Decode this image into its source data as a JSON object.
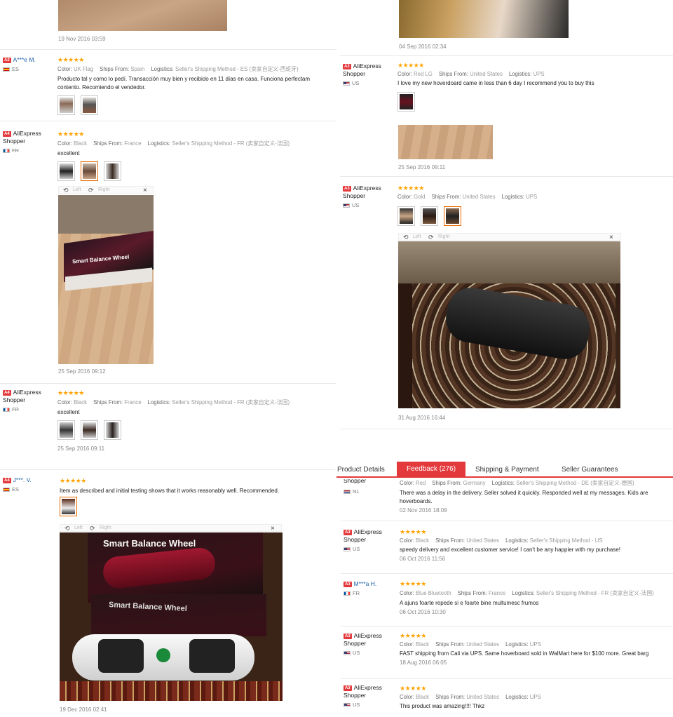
{
  "tabs": [
    "Product Details",
    "Feedback (276)",
    "Shipping & Payment",
    "Seller Guarantees"
  ],
  "viewer": {
    "left": "Left",
    "right": "Right",
    "close": "×"
  },
  "labels": {
    "color": "Color:",
    "ships_from": "Ships From:",
    "logistics": "Logistics:"
  },
  "stars": "★★★★★",
  "q1": {
    "top_date": "19 Nov 2016 03:59",
    "reviews": [
      {
        "level": "A2",
        "name": "A***e M.",
        "country": "ES",
        "color": "UK Flag",
        "ships_from": "Spain",
        "logistics": "Seller's Shipping Method - ES (卖家自定义-西班牙)",
        "text": "Producto tal y como lo pedí. Transacción muy bien y recibido en 11 días en casa. Funciona perfectam",
        "text2": "contento. Recomiendo el vendedor."
      },
      {
        "level": "A4",
        "name": "AliExpress",
        "name2": "Shopper",
        "country": "FR",
        "color": "Black",
        "ships_from": "France",
        "logistics": "Seller's Shipping Method - FR (卖家自定义-法国)",
        "text": "excellent",
        "date": "25 Sep 2016 09:12"
      },
      {
        "level": "A4",
        "name": "AliExpress",
        "name2": "Shopper",
        "country": "FR",
        "color": "Black",
        "ships_from": "France",
        "logistics": "Seller's Shipping Method - FR (卖家自定义-法国)",
        "text": "excellent",
        "date": "25 Sep 2016 09:11"
      }
    ],
    "photo_text": [
      "Smart Balance Wheel"
    ]
  },
  "q2": {
    "top_date": "04 Sep 2016 02:34",
    "reviews": [
      {
        "level": "A2",
        "name": "AliExpress",
        "name2": "Shopper",
        "country": "US",
        "color": "Red LG",
        "ships_from": "United States",
        "logistics": "UPS",
        "text": "I love my new hoverdoard came in less than 6 day I recommend you to buy this",
        "date": "25 Sep 2016 09:11"
      },
      {
        "level": "A3",
        "name": "AliExpress",
        "name2": "Shopper",
        "country": "US",
        "color": "Gold",
        "ships_from": "United States",
        "logistics": "UPS",
        "date": "31 Aug 2016 16:44"
      }
    ]
  },
  "q3": {
    "review": {
      "level": "A4",
      "name": "J***. V.",
      "country": "ES",
      "text": "Item as described and initial testing shows that it works reasonably well. Recommended.",
      "date": "19 Dec 2016 02:41"
    },
    "photo_text": [
      "Smart Balance Wheel",
      "Smart Balance Wheel"
    ]
  },
  "q4": {
    "reviews": [
      {
        "name": "Shopper",
        "country": "NL",
        "color": "Red",
        "ships_from": "Germany",
        "logistics": "Seller's Shipping Method - DE (卖家自定义-德国)",
        "text": "There was a delay in the delivery. Seller solved it quickly. Responded well at my messages. Kids are",
        "text2": "hoverboards.",
        "date": "02 Nov 2016 18:09"
      },
      {
        "level": "A3",
        "name": "AliExpress",
        "name2": "Shopper",
        "country": "US",
        "color": "Black",
        "ships_from": "United States",
        "logistics": "Seller's Shipping Method - US",
        "text": "speedy delivery and excellent customer service! I can't be any happier with my purchase!",
        "date": "06 Oct 2016 11:56"
      },
      {
        "level": "A3",
        "name": "M***a H.",
        "country": "FR",
        "color": "Blue Bluetooth",
        "ships_from": "France",
        "logistics": "Seller's Shipping Method - FR (卖家自定义-法国)",
        "text": "A ajuns foarte repede si e foarte bine multumesc frumos",
        "date": "06 Oct 2016 10:30"
      },
      {
        "level": "A3",
        "name": "AliExpress",
        "name2": "Shopper",
        "country": "US",
        "color": "Black",
        "ships_from": "United States",
        "logistics": "UPS",
        "text": "FAST shipping from Cali via UPS. Same hoverboard sold in WalMart here for $100 more. Great barg",
        "date": "18 Aug 2016 06:05"
      },
      {
        "level": "A3",
        "name": "AliExpress",
        "name2": "Shopper",
        "country": "US",
        "color": "Black",
        "ships_from": "United States",
        "logistics": "UPS",
        "text": "This product was amazing!!!! Thkz"
      }
    ]
  }
}
